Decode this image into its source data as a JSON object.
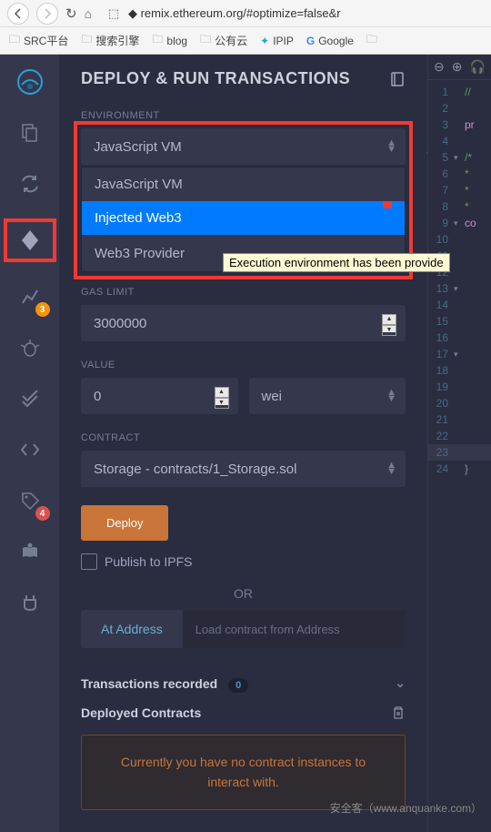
{
  "browser": {
    "url": "remix.ethereum.org/#optimize=false&r",
    "bookmarks": [
      "SRC平台",
      "搜索引擎",
      "blog",
      "公有云",
      "IPIP",
      "Google"
    ]
  },
  "panel": {
    "title": "DEPLOY & RUN TRANSACTIONS"
  },
  "environment": {
    "label": "ENVIRONMENT",
    "selected": "JavaScript VM",
    "options": [
      "JavaScript VM",
      "Injected Web3",
      "Web3 Provider"
    ],
    "tooltip": "Execution environment has been provide"
  },
  "gaslimit": {
    "label": "GAS LIMIT",
    "value": "3000000"
  },
  "value": {
    "label": "VALUE",
    "amount": "0",
    "unit": "wei"
  },
  "contract": {
    "label": "CONTRACT",
    "selected": "Storage - contracts/1_Storage.sol"
  },
  "deploy": {
    "button": "Deploy",
    "publish": "Publish to IPFS",
    "or": "OR",
    "atAddress": "At Address",
    "placeholder": "Load contract from Address"
  },
  "tx": {
    "label": "Transactions recorded",
    "count": "0"
  },
  "deployed": {
    "label": "Deployed Contracts"
  },
  "alert": {
    "text": "Currently you have no contract instances to interact with."
  },
  "sidebar": {
    "badge1": "3",
    "badge2": "4"
  },
  "editor": {
    "lines": [
      {
        "n": "1",
        "fold": "",
        "code": "//",
        "cls": "cm"
      },
      {
        "n": "2",
        "fold": "",
        "code": "",
        "cls": ""
      },
      {
        "n": "3",
        "fold": "",
        "code": "pr",
        "cls": "kw"
      },
      {
        "n": "4",
        "fold": "",
        "code": "",
        "cls": ""
      },
      {
        "n": "5",
        "fold": "▾",
        "code": "/*",
        "cls": "cm"
      },
      {
        "n": "6",
        "fold": "",
        "code": " *",
        "cls": "cm"
      },
      {
        "n": "7",
        "fold": "",
        "code": " *",
        "cls": "cm"
      },
      {
        "n": "8",
        "fold": "",
        "code": " *",
        "cls": "cm"
      },
      {
        "n": "9",
        "fold": "▾",
        "code": "co",
        "cls": "kw"
      },
      {
        "n": "10",
        "fold": "",
        "code": "",
        "cls": ""
      },
      {
        "n": "11",
        "fold": "",
        "code": "",
        "cls": ""
      },
      {
        "n": "12",
        "fold": "",
        "code": "",
        "cls": ""
      },
      {
        "n": "13",
        "fold": "▾",
        "code": "",
        "cls": ""
      },
      {
        "n": "14",
        "fold": "",
        "code": "",
        "cls": ""
      },
      {
        "n": "15",
        "fold": "",
        "code": "",
        "cls": ""
      },
      {
        "n": "16",
        "fold": "",
        "code": "",
        "cls": ""
      },
      {
        "n": "17",
        "fold": "▾",
        "code": "",
        "cls": ""
      },
      {
        "n": "18",
        "fold": "",
        "code": "",
        "cls": ""
      },
      {
        "n": "19",
        "fold": "",
        "code": "",
        "cls": ""
      },
      {
        "n": "20",
        "fold": "",
        "code": "",
        "cls": ""
      },
      {
        "n": "21",
        "fold": "",
        "code": "",
        "cls": ""
      },
      {
        "n": "22",
        "fold": "",
        "code": "",
        "cls": ""
      },
      {
        "n": "23",
        "fold": "",
        "code": "",
        "cls": "",
        "hl": true
      },
      {
        "n": "24",
        "fold": "",
        "code": "}",
        "cls": ""
      }
    ]
  },
  "watermark": "安全客（www.anquanke.com）"
}
